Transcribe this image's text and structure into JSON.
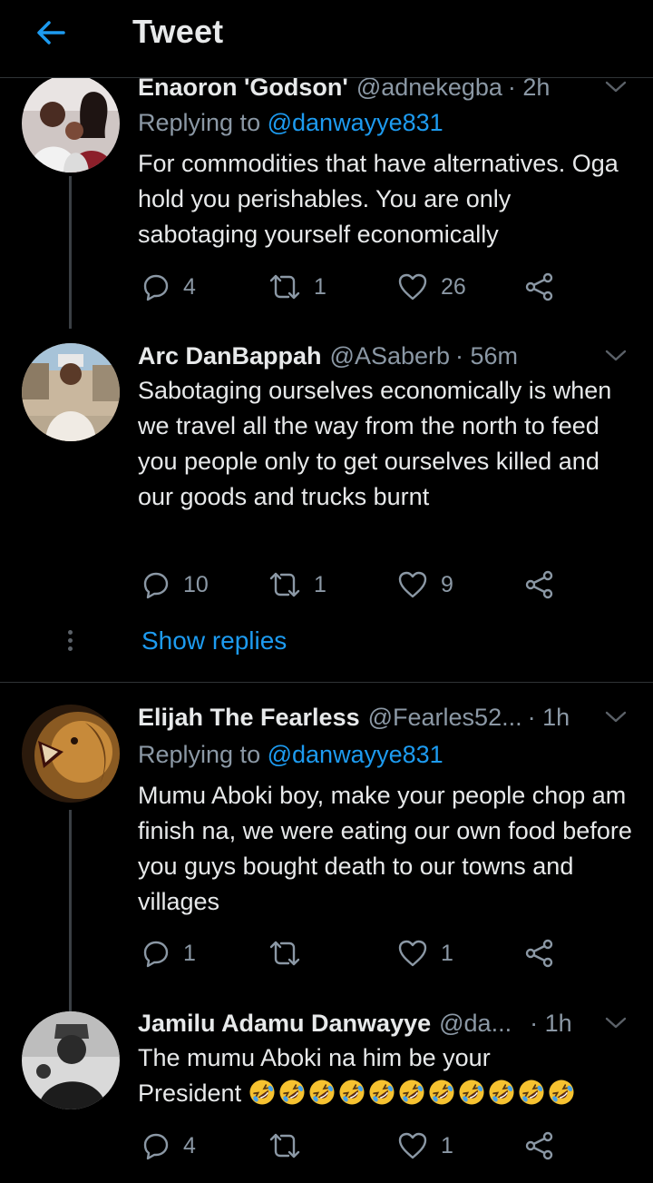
{
  "header": {
    "title": "Tweet",
    "back_icon": "back-arrow-icon",
    "accent": "#1d9bf0"
  },
  "tweets": [
    {
      "name": "Enaoron 'Godson'",
      "handle": "@adnekegba",
      "time": "· 2h",
      "replying_prefix": "Replying to",
      "replying_to": "@danwayye831",
      "text": "For commodities that have alternatives. Oga hold you perishables. You are only sabotaging yourself economically",
      "replies": "4",
      "retweets": "1",
      "likes": "26"
    },
    {
      "name": "Arc DanBappah",
      "handle": "@ASaberb",
      "time": "· 56m",
      "text": "Sabotaging ourselves economically is when we travel all the way from the north to feed you people only to get ourselves killed and our goods and trucks burnt",
      "replies": "10",
      "retweets": "1",
      "likes": "9"
    },
    {
      "name": "Elijah The Fearless",
      "handle": "@Fearles52...",
      "time": "· 1h",
      "replying_prefix": "Replying to",
      "replying_to": "@danwayye831",
      "text": "Mumu Aboki boy, make your people chop am finish na, we were eating our own food before you guys bought death to our towns and villages",
      "replies": "1",
      "retweets": "",
      "likes": "1"
    },
    {
      "name": "Jamilu Adamu Danwayye",
      "handle": "@da...",
      "time": "· 1h",
      "text_line1": "The mumu Aboki na him be your",
      "text_line2": "President",
      "emoji_count": 11,
      "emoji_name": "rolling-on-floor-laughing-emoji",
      "replies": "4",
      "retweets": "",
      "likes": "1"
    }
  ],
  "show_replies": "Show replies",
  "colors": {
    "background": "#000000",
    "text": "#e7e9ea",
    "secondary": "#8b98a5",
    "link": "#1d9bf0",
    "divider": "#2f3336"
  }
}
